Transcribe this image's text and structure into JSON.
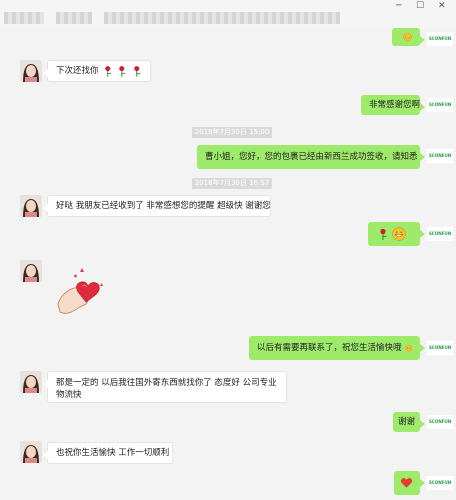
{
  "window": {
    "minimize": "─",
    "maximize": "☐",
    "close": "✕"
  },
  "messages": {
    "m1": {
      "text": "下次还找你"
    },
    "m2": {
      "text": "非常感谢您啊"
    },
    "ts1": "2018年7月30日 15:00",
    "m3": {
      "text": "曹小姐，您好，您的包裹已经由新西兰成功签收，请知悉"
    },
    "ts2": "2018年7月30日 16:57",
    "m4": {
      "text": "好哒 我朋友已经收到了 非常感想您的提醒 超级快 谢谢您"
    },
    "m7": {
      "text": "以后有需要再联系了，祝您生活愉快哦"
    },
    "m8": {
      "text": "那是一定的 以后我往国外寄东西就找你了 态度好 公司专业 物流快"
    },
    "m9": {
      "text": "谢谢"
    },
    "m10": {
      "text": "也祝你生活愉快 工作一切顺利"
    }
  },
  "brand": {
    "logo_text": "SCONFUN",
    "color": "#2f9c4a"
  },
  "colors": {
    "out_bubble": "#9eea6a",
    "in_bubble": "#ffffff",
    "background": "#f3f3f3"
  }
}
